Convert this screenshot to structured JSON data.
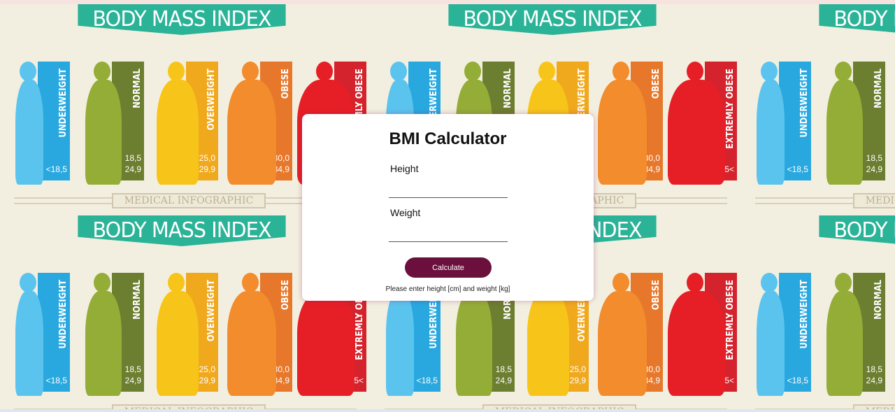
{
  "background": {
    "banner_text": "BODY MASS INDEX",
    "footer_text": "MEDICAL INFOGRAPHIC",
    "categories": [
      {
        "label": "UNDERWEIGHT",
        "range": "<18,5",
        "color": "#29a8e0",
        "figure": "#5bc4ee"
      },
      {
        "label": "NORMAL",
        "range": "18,5\n24,9",
        "color": "#6c7e2f",
        "figure": "#93ad37"
      },
      {
        "label": "OVERWEIGHT",
        "range": "25,0\n29,9",
        "color": "#f0a81d",
        "figure": "#f7c51a"
      },
      {
        "label": "OBESE",
        "range": "30,0\n34,9",
        "color": "#e7772a",
        "figure": "#f28c2c"
      },
      {
        "label": "EXTREMLY OBESE",
        "range": "35<",
        "color": "#d4232c",
        "figure": "#e61f27"
      }
    ]
  },
  "card": {
    "title": "BMI Calculator",
    "height_label": "Height",
    "height_value": "",
    "weight_label": "Weight",
    "weight_value": "",
    "button_label": "Calculate",
    "message": "Please enter height [cm] and weight [kg]"
  },
  "colors": {
    "accent": "#6b0f3c",
    "banner": "#2bb397"
  }
}
